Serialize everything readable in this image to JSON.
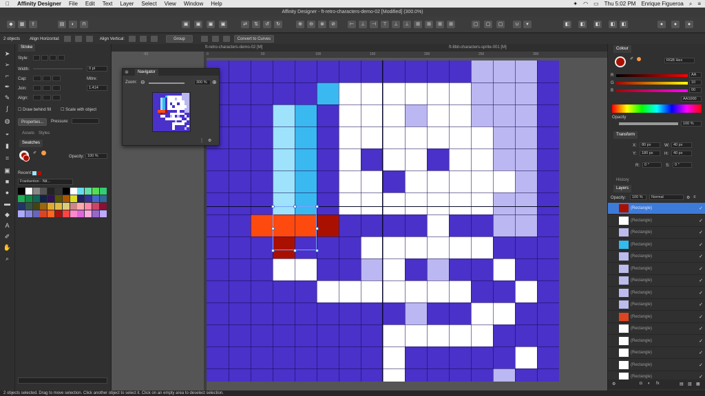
{
  "menubar": {
    "app": "Affinity Designer",
    "items": [
      "File",
      "Edit",
      "Text",
      "Layer",
      "Select",
      "View",
      "Window",
      "Help"
    ],
    "clock": "Thu 5:02 PM",
    "user": "Enrique Figueroa"
  },
  "title": "Affinity Designer - ft-retro-characters-demo-02 [Modified] (300.0%)",
  "context": {
    "selection": "2 objects",
    "align_h": "Align Horizontal:",
    "align_v": "Align Vertical:",
    "group": "Group",
    "convert": "Convert to Curves"
  },
  "stroke": {
    "tab": "Stroke",
    "style": "Style:",
    "width": "Width:",
    "width_val": "0 pt",
    "cap": "Cap:",
    "join": "Join:",
    "align": "Align:",
    "mitre": "Mitre:",
    "mitre_val": "1.414",
    "behind": "Draw behind fill",
    "scale": "Scale with object",
    "properties": "Properties...",
    "pressure": "Pressure:"
  },
  "assets": {
    "tab1": "Assets",
    "tab2": "Styles",
    "swatches": "Swatches",
    "opacity": "Opacity:",
    "opacity_val": "100 %",
    "recent": "Recent:",
    "palette": "Frankenton - Nit..."
  },
  "palette_colors": [
    "#000000",
    "#ffffff",
    "#888888",
    "#555555",
    "#222222",
    "#333333",
    "#000000",
    "#ffffff",
    "#66ddee",
    "#66ddaa",
    "#55dd55",
    "#33cc77",
    "#22aa55",
    "#118844",
    "#116655",
    "#112244",
    "#331155",
    "#555500",
    "#aa5500",
    "#dddd22",
    "#222266",
    "#333399",
    "#4466cc",
    "#336699",
    "#223366",
    "#335544",
    "#444411",
    "#996611",
    "#ddaa33",
    "#ddbb44",
    "#ddcc77",
    "#cc8888",
    "#ffaaaa",
    "#ff88aa",
    "#cc4466",
    "#881133",
    "#aaaaff",
    "#8888dd",
    "#6666bb",
    "#dd4422",
    "#ff6622",
    "#aa1111",
    "#ff4444",
    "#ff88cc",
    "#dd66dd",
    "#ffaadd",
    "#9966cc",
    "#bbaaff"
  ],
  "navigator": {
    "title": "Navigator",
    "zoom": "Zoom:",
    "zoom_val": "300 %"
  },
  "tabs": {
    "doc1": "ft-retro-characters-demo-02 [M]",
    "doc2": "ft-8bit-characters-sprite-001 [M]"
  },
  "ruler": [
    "-50",
    "0",
    "50",
    "100",
    "150",
    "200",
    "250",
    "300"
  ],
  "colour": {
    "tab": "Colour",
    "mode": "RGB Hex",
    "r_lbl": "R",
    "g_lbl": "G",
    "b_lbl": "B",
    "r": "AA",
    "g": "10",
    "b": "00",
    "hex": "AA1000",
    "opacity": "Opacity",
    "opacity_val": "100 %"
  },
  "transform": {
    "tab": "Transform",
    "x_lbl": "X:",
    "x": "80 px",
    "y_lbl": "Y:",
    "y": "180 px",
    "w_lbl": "W:",
    "w": "40 px",
    "h_lbl": "H:",
    "h": "40 px",
    "r_lbl": "R:",
    "r": "0 °",
    "s_lbl": "S:",
    "s": "0 °"
  },
  "history": "History",
  "layers": {
    "tab": "Layers",
    "opacity": "Opacity:",
    "opacity_val": "100 %",
    "blend": "Normal",
    "name": "(Rectangle)",
    "check": "✓",
    "rows": [
      {
        "thumb": "#aa1000",
        "sel": true
      },
      {
        "thumb": "#ffffff"
      },
      {
        "thumb": "#bbbbee"
      },
      {
        "thumb": "#33bbee"
      },
      {
        "thumb": "#bbbbee"
      },
      {
        "thumb": "#bbbbee"
      },
      {
        "thumb": "#bbbbee"
      },
      {
        "thumb": "#bbbbee"
      },
      {
        "thumb": "#bbbbee"
      },
      {
        "thumb": "#dd4422"
      },
      {
        "thumb": "#ffffff"
      },
      {
        "thumb": "#ffffff"
      },
      {
        "thumb": "#ffffff"
      },
      {
        "thumb": "#ffffff"
      },
      {
        "thumb": "#ffffff"
      }
    ]
  },
  "status": "2 objects selected. Drag to move selection. Click another object to select it. Click on an empty area to deselect selection.",
  "sprite_rows": [
    "............lll.",
    ".....Cwwwwwwlll.",
    "...cC.wwwlwwlll.",
    "...cC.wwwwwwwll.",
    "...cC.w.ww.wwll.",
    "...cC.ww.wwwwwl.",
    "...cC.wwwwwwwll.",
    "..RRRr....w..ll.",
    "...r...wwwwww...",
    "...ww..lw.l..w..",
    ".....wwwwwww..w.",
    ".........l..ww..",
    "........wwwww...",
    "........w.....w.",
    "........w....l..",
    "................"
  ],
  "sprite_colors": {
    ".": "#4a31c9",
    "w": "#ffffff",
    "l": "#bbb7f2",
    "c": "#9ee2fb",
    "C": "#3ab8f0",
    "R": "#ff4a0f",
    "r": "#aa1000"
  }
}
